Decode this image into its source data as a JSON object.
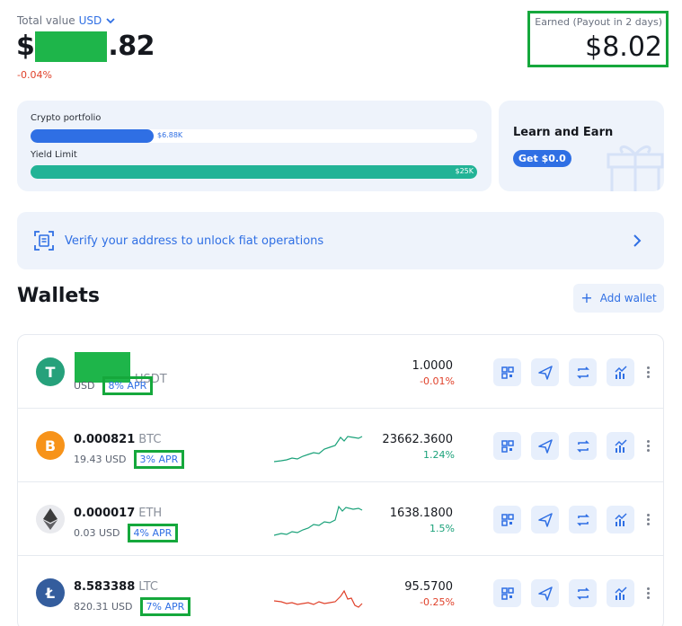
{
  "total_value": {
    "label": "Total value",
    "currency": "USD",
    "prefix": "$",
    "suffix": ".82",
    "change": "-0.04%"
  },
  "earned": {
    "label": "Earned (Payout in 2 days)",
    "value": "$8.02"
  },
  "portfolio_card": {
    "crypto_label": "Crypto portfolio",
    "crypto_value": "$6.88K",
    "crypto_fill_fraction": 0.275,
    "yield_label": "Yield Limit",
    "yield_value": "$25K",
    "yield_fill_fraction": 1.0
  },
  "learn_card": {
    "title": "Learn and Earn",
    "button": "Get $0.0"
  },
  "verify_banner": {
    "text": "Verify your address to unlock fiat operations"
  },
  "wallets": {
    "title": "Wallets",
    "add_label": "Add wallet",
    "rows": [
      {
        "amount": "",
        "symbol": "USDT",
        "usd": "USD",
        "apr": "8% APR",
        "price": "1.0000",
        "change": "-0.01%",
        "change_color": "#e0412a",
        "icon_color": "#26a17b",
        "icon_glyph": "T"
      },
      {
        "amount": "0.000821",
        "symbol": "BTC",
        "usd": "19.43 USD",
        "apr": "3% APR",
        "price": "23662.3600",
        "change": "1.24%",
        "change_color": "#1ba27a",
        "icon_color": "#f7931a",
        "icon_glyph": "B"
      },
      {
        "amount": "0.000017",
        "symbol": "ETH",
        "usd": "0.03 USD",
        "apr": "4% APR",
        "price": "1638.1800",
        "change": "1.5%",
        "change_color": "#1ba27a",
        "icon_color": "#e9eaee",
        "icon_glyph": ""
      },
      {
        "amount": "8.583388",
        "symbol": "LTC",
        "usd": "820.31 USD",
        "apr": "7% APR",
        "price": "95.5700",
        "change": "-0.25%",
        "change_color": "#e0412a",
        "icon_color": "#345d9d",
        "icon_glyph": "Ł"
      }
    ]
  },
  "colors": {
    "accent": "#2f6fe4",
    "positive": "#1ba27a",
    "negative": "#e0412a",
    "highlight_box": "#15a83c"
  }
}
